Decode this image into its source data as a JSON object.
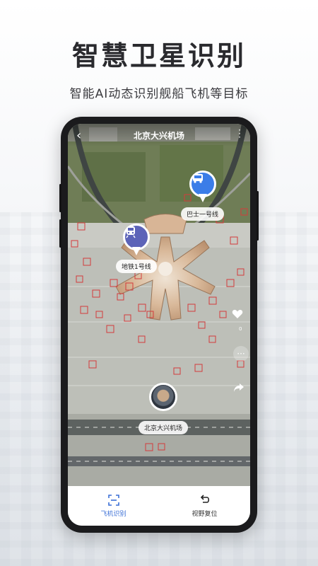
{
  "promo": {
    "headline": "智慧卫星识别",
    "subline": "智能AI动态识别舰船飞机等目标"
  },
  "app": {
    "title": "北京大兴机场",
    "back_icon": "back-arrow-icon",
    "more_icon": "more-vertical-icon"
  },
  "markers": {
    "bus_label": "巴士一号线",
    "metro_label": "地铁1号线",
    "airport_label": "北京大兴机场"
  },
  "side_controls": {
    "like_count": "0",
    "icons": [
      "heart-icon",
      "more-horizontal-icon",
      "share-icon"
    ]
  },
  "bottom_tabs": [
    {
      "label": "飞机识别",
      "icon": "scan-icon",
      "active": true
    },
    {
      "label": "视野复位",
      "icon": "reset-view-icon",
      "active": false
    }
  ],
  "colors": {
    "accent": "#3b6fd6",
    "metro_pin": "#5c63b8",
    "bus_pin": "#3b7de8",
    "detection_box": "#d43b3b"
  }
}
